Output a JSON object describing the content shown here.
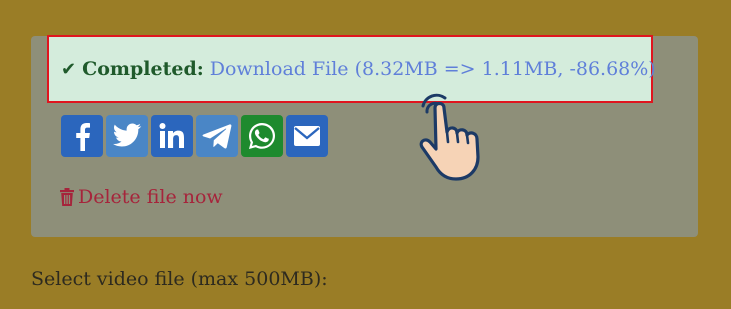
{
  "alert": {
    "check_icon": "checkmark-icon",
    "label": "Completed:",
    "link": "Download File (8.32MB => 1.11MB, -86.68%)",
    "border_color": "#e0151f",
    "bg_color": "#d4ecdc"
  },
  "share": {
    "buttons": [
      {
        "name": "facebook",
        "icon": "facebook-icon",
        "color": "#2b66bd"
      },
      {
        "name": "twitter",
        "icon": "twitter-icon",
        "color": "#4a86c6"
      },
      {
        "name": "linkedin",
        "icon": "linkedin-icon",
        "color": "#2b66bd"
      },
      {
        "name": "telegram",
        "icon": "telegram-icon",
        "color": "#4a86c6"
      },
      {
        "name": "whatsapp",
        "icon": "whatsapp-icon",
        "color": "#1e8a2e"
      },
      {
        "name": "email",
        "icon": "mail-icon",
        "color": "#2b66bd"
      }
    ]
  },
  "delete": {
    "icon": "trash-icon",
    "label": "Delete file now"
  },
  "upload": {
    "label": "Select video file (max 500MB):"
  },
  "overlay": {
    "icon": "pointing-hand-icon"
  }
}
